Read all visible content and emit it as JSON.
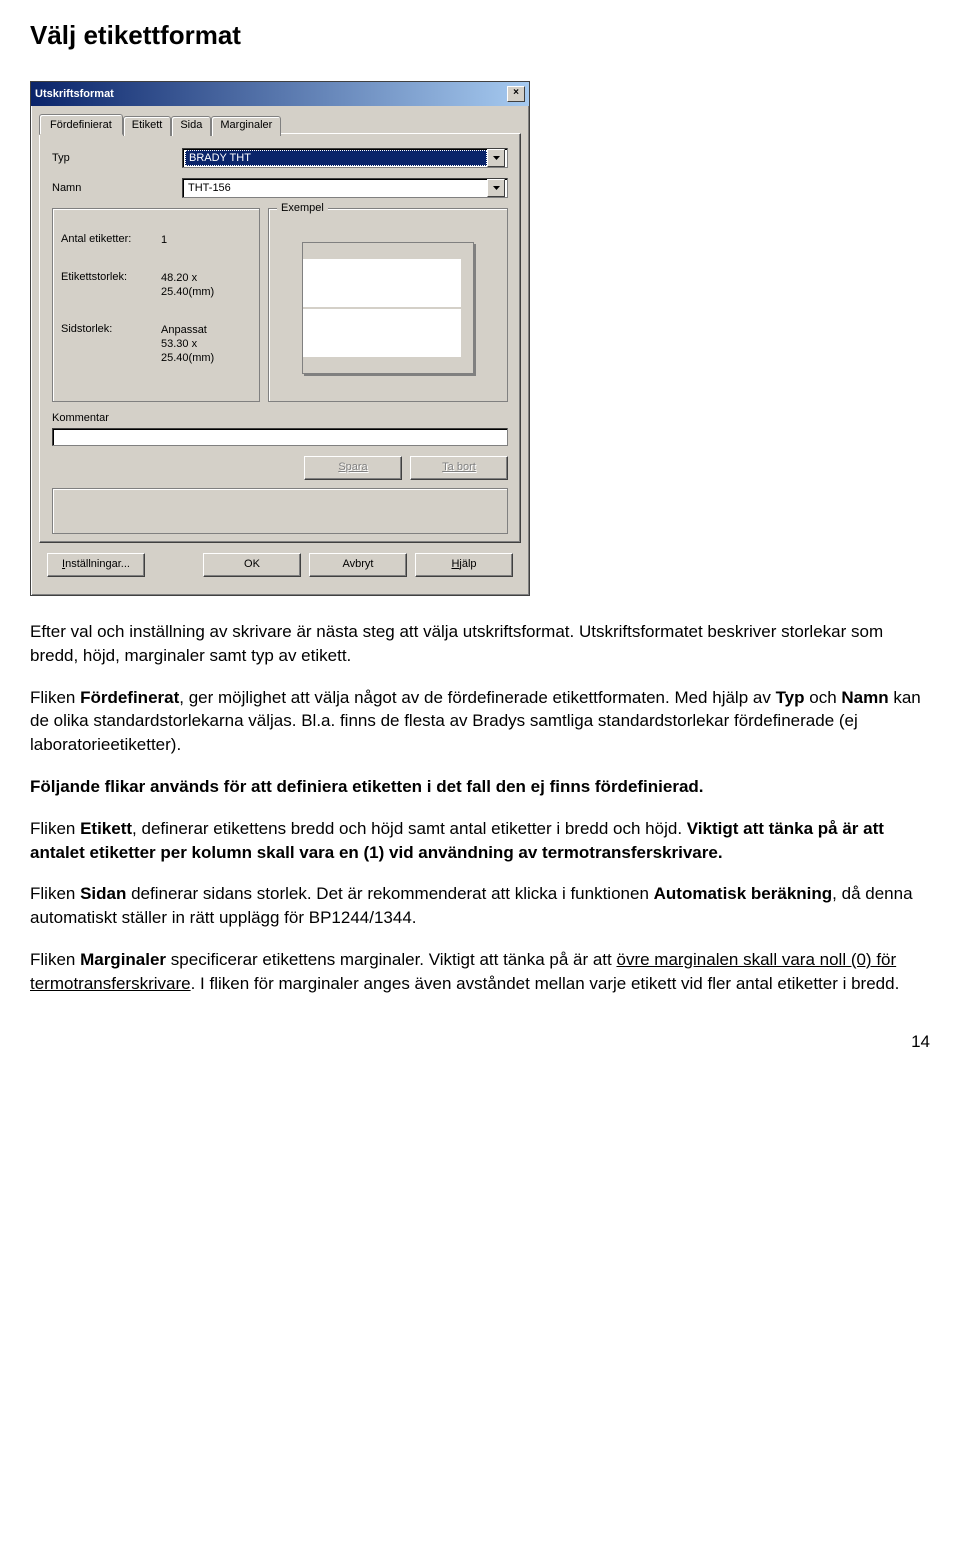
{
  "heading": "Välj etikettformat",
  "dialog": {
    "title": "Utskriftsformat",
    "close_glyph": "×",
    "tabs": [
      "Fördefinierat",
      "Etikett",
      "Sida",
      "Marginaler"
    ],
    "type_label": "Typ",
    "type_value": "BRADY THT",
    "name_label": "Namn",
    "name_value": "THT-156",
    "info": {
      "count_key": "Antal etiketter:",
      "count_val": "1",
      "labelsize_key": "Etikettstorlek:",
      "labelsize_val": "48.20 x\n25.40(mm)",
      "pagesize_key": "Sidstorlek:",
      "pagesize_val": "Anpassat\n53.30 x\n25.40(mm)"
    },
    "example_label": "Exempel",
    "comment_label": "Kommentar",
    "save_label": "Spara",
    "delete_label": "Ta bort",
    "settings_label": "Inställningar...",
    "ok_label": "OK",
    "cancel_label": "Avbryt",
    "help_label": "Hjälp"
  },
  "paragraphs": {
    "p1": "Efter val och inställning av skrivare är nästa steg att välja utskriftsformat. Utskriftsformatet beskriver storlekar som bredd, höjd, marginaler samt typ av etikett.",
    "p2a": "Fliken ",
    "p2b": "Fördefinerat",
    "p2c": ", ger möjlighet att välja något av de fördefinerade etikettformaten. Med hjälp av ",
    "p2d": "Typ",
    "p2e": " och ",
    "p2f": "Namn",
    "p2g": " kan de olika standardstorlekarna väljas. Bl.a. finns de flesta av Bradys samtliga standardstorlekar fördefinerade (ej laboratorieetiketter).",
    "p3": "Följande flikar används för att definiera etiketten i det fall den ej finns fördefinierad.",
    "p4a": "Fliken ",
    "p4b": "Etikett",
    "p4c": ", definerar etikettens bredd och höjd samt antal etiketter i bredd och höjd. ",
    "p4d": "Viktigt att tänka på är att antalet etiketter per kolumn skall vara en (1) vid användning av termotransferskrivare.",
    "p5a": "Fliken ",
    "p5b": "Sidan",
    "p5c": " definerar sidans storlek. Det är rekommenderat att klicka i funktionen ",
    "p5d": "Automatisk beräkning",
    "p5e": ", då denna automatiskt ställer in rätt upplägg för BP1244/1344.",
    "p6a": "Fliken ",
    "p6b": "Marginaler",
    "p6c": " specificerar etikettens marginaler. Viktigt att tänka på är att ",
    "p6d": "övre marginalen skall vara noll (0) för termotransferskrivare",
    "p6e": ". I fliken för marginaler anges även avståndet mellan varje etikett vid fler antal etiketter i bredd."
  },
  "page_number": "14"
}
